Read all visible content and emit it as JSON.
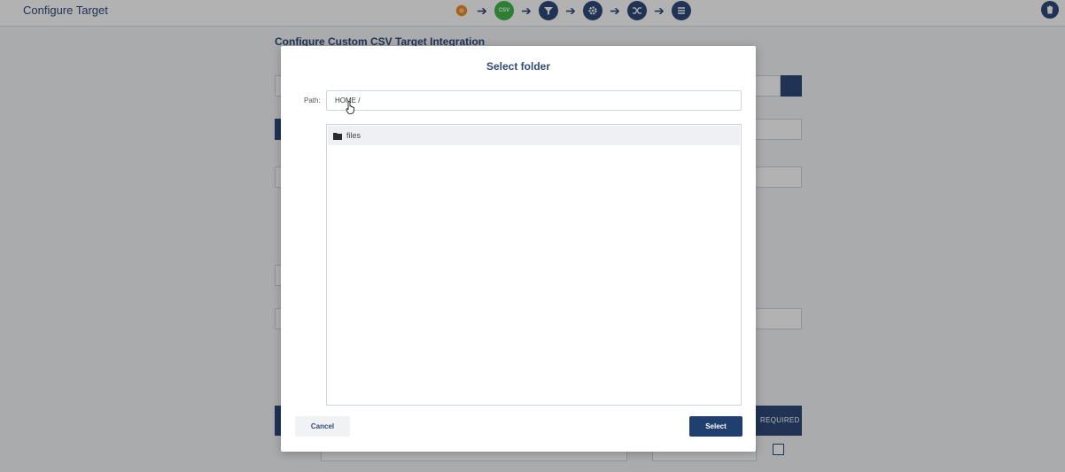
{
  "header": {
    "title": "Configure Target",
    "steps": [
      {
        "icon": "source-icon"
      },
      {
        "icon": "csv-icon",
        "label": "CSV"
      },
      {
        "icon": "filter-icon"
      },
      {
        "icon": "gear-icon"
      },
      {
        "icon": "shuffle-icon"
      },
      {
        "icon": "list-icon"
      }
    ]
  },
  "page": {
    "heading": "Configure Custom CSV Target Integration",
    "table_required_header": "REQUIRED"
  },
  "dialog": {
    "title": "Select folder",
    "path_label": "Path:",
    "path_value": "HOME /",
    "folders": [
      {
        "name": "files",
        "icon": "folder-icon"
      }
    ],
    "cancel_label": "Cancel",
    "select_label": "Select"
  },
  "colors": {
    "primary": "#2f4a7a",
    "select_button": "#1f3f6e",
    "csv_step": "#43b54a"
  }
}
